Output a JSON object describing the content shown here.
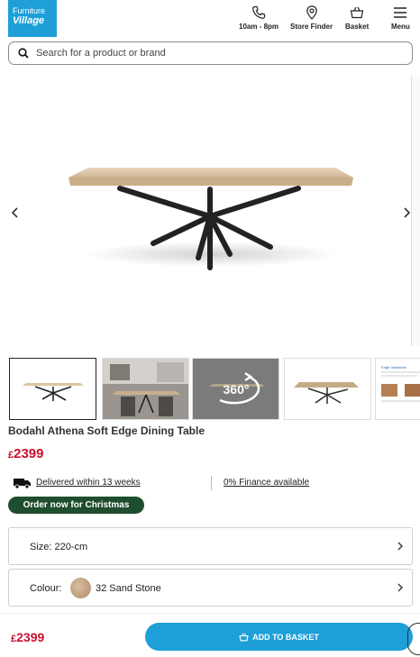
{
  "header": {
    "logo_line1": "Furniture",
    "logo_line2": "Village",
    "nav": [
      {
        "label": "10am - 8pm",
        "icon": "phone-icon"
      },
      {
        "label": "Store Finder",
        "icon": "location-pin-icon"
      },
      {
        "label": "Basket",
        "icon": "basket-icon"
      },
      {
        "label": "Menu",
        "icon": "hamburger-menu-icon"
      }
    ]
  },
  "search": {
    "placeholder": "Search for a product or brand"
  },
  "gallery": {
    "thumbnails": [
      {
        "name": "thumb-table-main"
      },
      {
        "name": "thumb-room-scene"
      },
      {
        "name": "thumb-360-view",
        "label": "360°"
      },
      {
        "name": "thumb-table-angle"
      },
      {
        "name": "thumb-care-sheet",
        "label": "Edge Variations"
      }
    ]
  },
  "product": {
    "title": "Bodahl Athena Soft Edge Dining Table",
    "currency": "£",
    "price": "2399",
    "delivery": "Delivered within 13 weeks",
    "finance": "0% Finance available",
    "badge": "Order now for Christmas"
  },
  "options": {
    "size_label": "Size: 220-cm",
    "colour_label": "Colour:",
    "colour_value": "32 Sand Stone"
  },
  "bottom_bar": {
    "currency": "£",
    "price": "2399",
    "add_button": "ADD TO BASKET"
  },
  "colors": {
    "brand_blue": "#1e9fd8",
    "price_red": "#c8102e",
    "badge_green": "#1f4d2f"
  }
}
